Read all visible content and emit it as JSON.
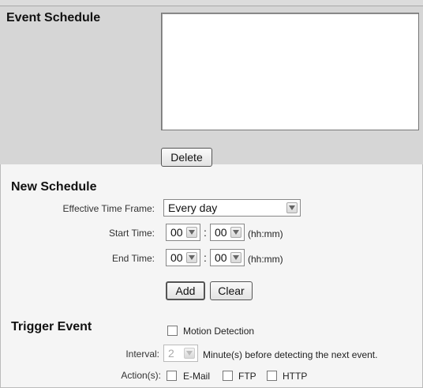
{
  "event_schedule": {
    "title": "Event Schedule",
    "entries": [],
    "delete_label": "Delete"
  },
  "new_schedule": {
    "title": "New Schedule",
    "effective_time_frame_label": "Effective Time Frame:",
    "effective_time_frame_value": "Every day",
    "start_time_label": "Start Time:",
    "start_hour": "00",
    "start_minute": "00",
    "end_time_label": "End Time:",
    "end_hour": "00",
    "end_minute": "00",
    "separator": ":",
    "time_format": "(hh:mm)",
    "add_label": "Add",
    "clear_label": "Clear"
  },
  "trigger_event": {
    "title": "Trigger Event",
    "motion_detection_label": "Motion Detection",
    "motion_detection_checked": false,
    "interval_label": "Interval:",
    "interval_value": "2",
    "interval_suffix": "Minute(s) before detecting the next event.",
    "actions_label": "Action(s):",
    "actions": [
      {
        "label": "E-Mail",
        "checked": false
      },
      {
        "label": "FTP",
        "checked": false
      },
      {
        "label": "HTTP",
        "checked": false
      }
    ]
  },
  "icons": {
    "dropdown": "chevron-down-icon",
    "checkbox": "checkbox-icon"
  },
  "colors": {
    "panel_background": "#d6d6d6",
    "page_background": "#f5f5f5",
    "border": "#777777"
  }
}
